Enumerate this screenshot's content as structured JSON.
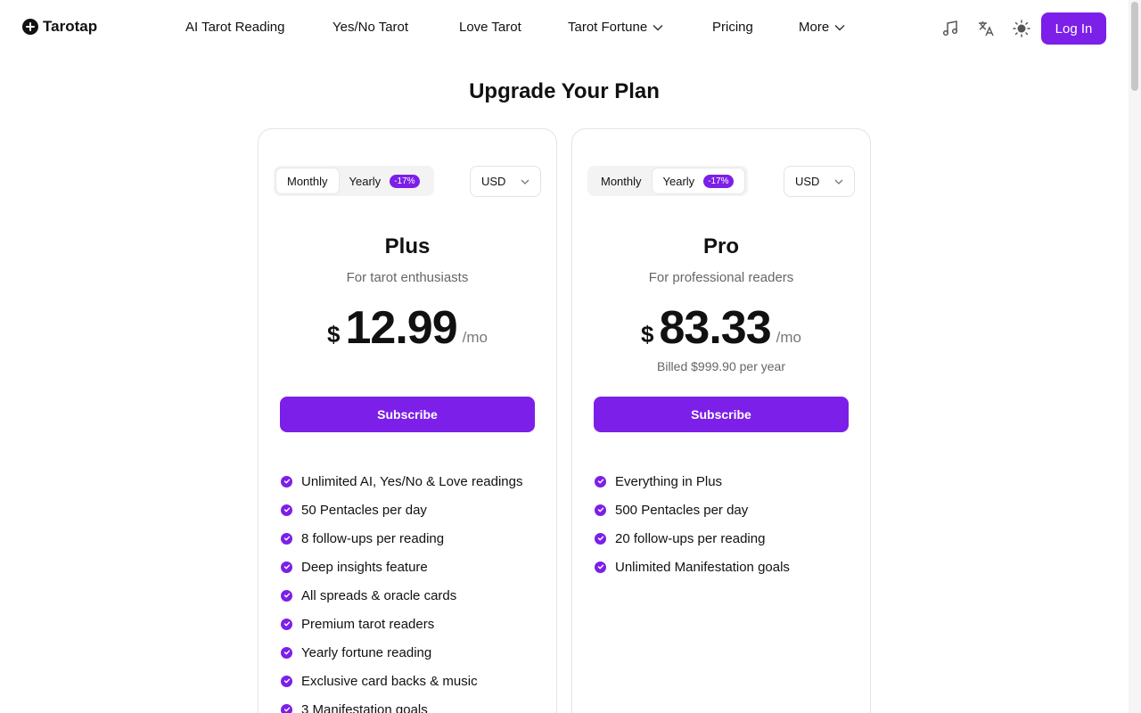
{
  "brand": {
    "name": "Tarotap"
  },
  "nav": {
    "items": [
      {
        "label": "AI Tarot Reading"
      },
      {
        "label": "Yes/No Tarot"
      },
      {
        "label": "Love Tarot"
      },
      {
        "label": "Tarot Fortune"
      },
      {
        "label": "Pricing"
      },
      {
        "label": "More"
      }
    ],
    "login_label": "Log In",
    "icons": [
      "music-icon",
      "translate-icon",
      "theme-sun-icon"
    ]
  },
  "page": {
    "title": "Upgrade Your Plan"
  },
  "colors": {
    "accent": "#7c1fe8"
  },
  "plans": [
    {
      "toggle": {
        "monthly": "Monthly",
        "yearly": "Yearly",
        "badge": "-17%",
        "selected": "Monthly"
      },
      "currency": "USD",
      "name": "Plus",
      "subtitle": "For tarot enthusiasts",
      "price_symbol": "$",
      "price": "12.99",
      "unit": "/mo",
      "billed": "",
      "cta": "Subscribe",
      "features": [
        "Unlimited AI, Yes/No & Love readings",
        "50 Pentacles per day",
        "8 follow-ups per reading",
        "Deep insights feature",
        "All spreads & oracle cards",
        "Premium tarot readers",
        "Yearly fortune reading",
        "Exclusive card backs & music",
        "3 Manifestation goals"
      ]
    },
    {
      "toggle": {
        "monthly": "Monthly",
        "yearly": "Yearly",
        "badge": "-17%",
        "selected": "Yearly"
      },
      "currency": "USD",
      "name": "Pro",
      "subtitle": "For professional readers",
      "price_symbol": "$",
      "price": "83.33",
      "unit": "/mo",
      "billed": "Billed $999.90 per year",
      "cta": "Subscribe",
      "features": [
        "Everything in Plus",
        "500 Pentacles per day",
        "20 follow-ups per reading",
        "Unlimited Manifestation goals"
      ]
    }
  ]
}
